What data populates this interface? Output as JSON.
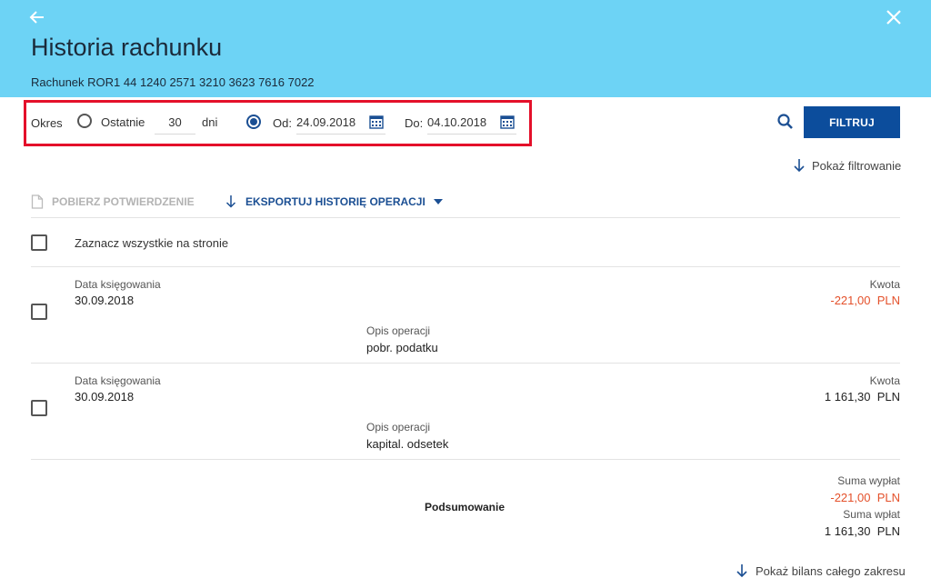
{
  "header": {
    "title": "Historia rachunku",
    "account": "Rachunek ROR1 44 1240 2571 3210 3623 7616 7022",
    "background": "#6dd3f5"
  },
  "filter": {
    "period_label": "Okres",
    "last_label": "Ostatnie",
    "last_value": "30",
    "days_label": "dni",
    "from_label": "Od:",
    "from_value": "24.09.2018",
    "to_label": "Do:",
    "to_value": "04.10.2018",
    "selected_mode": "range",
    "submit_label": "FILTRUJ",
    "show_filtering_label": "Pokaż filtrowanie"
  },
  "actions": {
    "download_confirmation": "POBIERZ POTWIERDZENIE",
    "export_history": "EKSPORTUJ HISTORIĘ OPERACJI"
  },
  "select_all_label": "Zaznacz wszystkie na stronie",
  "transactions": [
    {
      "date_label": "Data księgowania",
      "date": "30.09.2018",
      "amount_label": "Kwota",
      "amount": "-221,00",
      "currency": "PLN",
      "desc_label": "Opis operacji",
      "desc": "pobr. podatku"
    },
    {
      "date_label": "Data księgowania",
      "date": "30.09.2018",
      "amount_label": "Kwota",
      "amount": "1 161,30",
      "currency": "PLN",
      "desc_label": "Opis operacji",
      "desc": "kapital. odsetek"
    }
  ],
  "summary": {
    "label": "Podsumowanie",
    "withdrawals_label": "Suma wypłat",
    "withdrawals": "-221,00",
    "withdrawals_currency": "PLN",
    "deposits_label": "Suma wpłat",
    "deposits": "1 161,30",
    "deposits_currency": "PLN"
  },
  "show_balance_label": "Pokaż bilans całego zakresu",
  "colors": {
    "accent": "#0c4d9c",
    "negative": "#e4502a",
    "highlight": "#e4102a"
  }
}
